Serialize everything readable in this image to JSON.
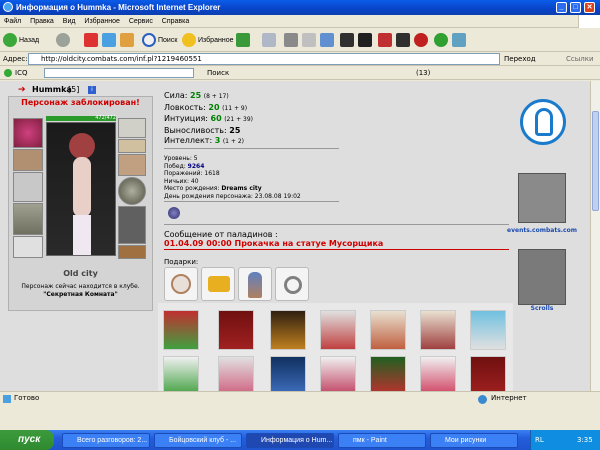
{
  "window": {
    "title": "Информация о Hummka - Microsoft Internet Explorer",
    "btn_min": "_",
    "btn_max": "□",
    "btn_close": "✕"
  },
  "menu": [
    "Файл",
    "Правка",
    "Вид",
    "Избранное",
    "Сервис",
    "Справка"
  ],
  "toolbar": {
    "back": "Назад",
    "search": "Поиск",
    "favorites": "Избранное"
  },
  "address": {
    "label": "Адрес:",
    "url": "http://oldcity.combats.com/inf.pl?1219460551",
    "go": "Переход",
    "links": "Ссылки"
  },
  "linksbar": {
    "icq": "ICQ",
    "search": "Поиск",
    "count": "(13)"
  },
  "profile": {
    "name": "Hummka",
    "level": "[5]",
    "blocked": "Персонаж заблокирован!",
    "hp": "472/472",
    "city": "Old city",
    "location": "Персонаж сейчас находится в клубе.",
    "room": "\"Секретная Комната\"",
    "stats": [
      {
        "label": "Сила:",
        "value": "25",
        "bonus": "(8 + 17)"
      },
      {
        "label": "Ловкость:",
        "value": "20",
        "bonus": "(11 + 9)"
      },
      {
        "label": "Интуиция:",
        "value": "60",
        "bonus": "(21 + 39)"
      },
      {
        "label": "Выносливость:",
        "value": "25",
        "bonus": ""
      },
      {
        "label": "Интеллект:",
        "value": "3",
        "bonus": "(1 + 2)"
      }
    ],
    "info": {
      "level": "Уровень: 5",
      "wins_label": "Побед:",
      "wins": "9264",
      "losses": "Поражений: 1618",
      "draws": "Ничьих: 40",
      "birthplace_label": "Место рождения:",
      "birthplace": "Dreams city",
      "birthday": "День рождения персонажа: 23.08.08 19:02"
    },
    "paladin_msg": "Сообщение от паладинов :",
    "paladin_text": "01.04.09 00:00 Прокачка на статуе Мусорщика",
    "gifts_label": "Подарки:"
  },
  "sidebar": {
    "events": "events.combats.com",
    "scrolls": "Scrolls"
  },
  "status": {
    "left": "Готово",
    "right": "Интернет"
  },
  "taskbar": {
    "start": "пуск",
    "tasks": [
      "Всего разговоров: 2...",
      "Бойцовский клуб - ...",
      "Информация о Hum...",
      "пмк - Paint",
      "Мои рисунки"
    ],
    "lang": "RL",
    "time": "3:35"
  },
  "colors": {
    "blocked": "#d00000",
    "stat_value": "#008000",
    "taskbar": "#245ddb",
    "titlebar": "#0843c8"
  }
}
